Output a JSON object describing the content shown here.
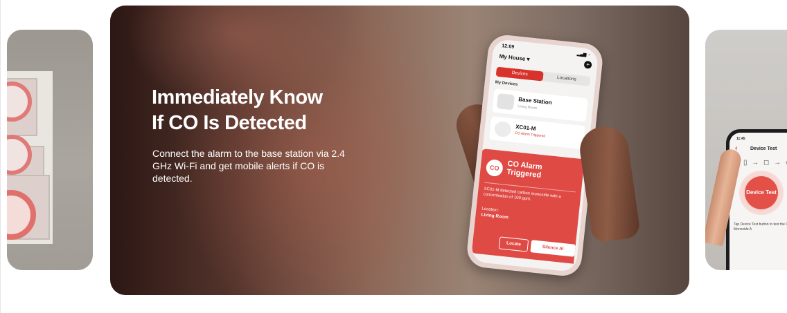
{
  "hero": {
    "title_line1": "Immediately Know",
    "title_line2": "If CO Is Detected",
    "description": "Connect the alarm to the base station via 2.4 GHz Wi-Fi and get mobile alerts if CO is detected."
  },
  "phone": {
    "time": "12:09",
    "home_selector": "My House",
    "tabs": [
      "Devices",
      "Locations"
    ],
    "section_label": "My Devices",
    "devices": [
      {
        "name": "Base Station",
        "status": "Living Room"
      },
      {
        "name": "XC01-M",
        "status": "CO Alarm Triggered"
      }
    ],
    "alert": {
      "icon_text": "CO",
      "title": "CO Alarm Triggered",
      "message": "XC01-M detected carbon monoxide with a concentration of 100 ppm.",
      "location_label": "Location:",
      "location": "Living Room",
      "locate_button": "Locate",
      "silence_button": "Silence Al"
    }
  },
  "right_card": {
    "screen_title": "Device Test",
    "time": "11:45",
    "button_label": "Device Test",
    "hint": "Tap Device Test button to test the Carbon Monoxide A"
  },
  "colors": {
    "accent": "#d8322c",
    "alert_bg": "#df4a45"
  }
}
